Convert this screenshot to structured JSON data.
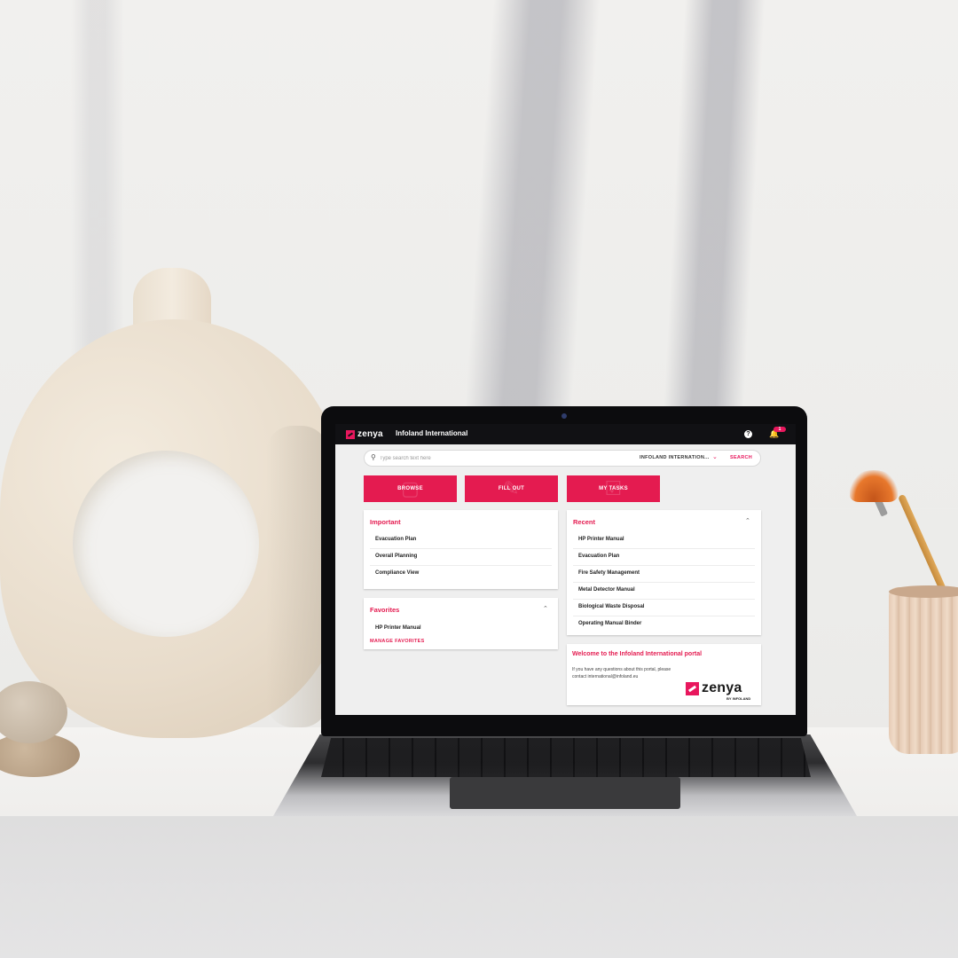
{
  "app": {
    "logo_text": "zenya",
    "title": "Infoland International",
    "help_label": "?",
    "notification_count": "1"
  },
  "search": {
    "placeholder": "Type search text here",
    "scope": "INFOLAND INTERNATION...",
    "button": "SEARCH"
  },
  "actions": [
    {
      "label": "BROWSE",
      "icon": "folder-icon"
    },
    {
      "label": "FILL OUT",
      "icon": "edit-icon"
    },
    {
      "label": "MY TASKS",
      "icon": "tasks-icon"
    }
  ],
  "important": {
    "title": "Important",
    "items": [
      "Evacuation Plan",
      "Overall Planning",
      "Compliance View"
    ]
  },
  "favorites": {
    "title": "Favorites",
    "items": [
      "HP Printer Manual"
    ],
    "manage_label": "MANAGE FAVORITES"
  },
  "recent": {
    "title": "Recent",
    "items": [
      "HP Printer Manual",
      "Evacuation Plan",
      "Fire Safety Management",
      "Metal Detector Manual",
      "Biological Waste Disposal",
      "Operating Manual Binder"
    ]
  },
  "welcome": {
    "title": "Welcome to the Infoland International portal",
    "line1": "If you have any questions about this portal, please",
    "line2": "contact international@infoland.eu",
    "logo_text": "zenya",
    "logo_sub": "BY INFOLAND"
  },
  "colors": {
    "accent": "#e41b50",
    "topbar": "#111114"
  }
}
